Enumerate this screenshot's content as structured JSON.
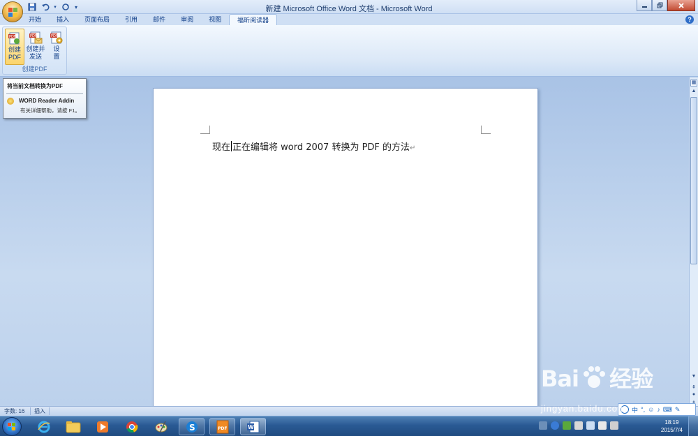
{
  "window": {
    "title": "新建 Microsoft Office Word 文档 - Microsoft Word"
  },
  "quick_access": {
    "save_icon": "save-icon",
    "undo_icon": "undo-icon",
    "redo_icon": "redo-icon"
  },
  "tabs": [
    {
      "label": "开始"
    },
    {
      "label": "插入"
    },
    {
      "label": "页面布局"
    },
    {
      "label": "引用"
    },
    {
      "label": "邮件"
    },
    {
      "label": "审阅"
    },
    {
      "label": "视图"
    },
    {
      "label": "福昕阅读器"
    }
  ],
  "active_tab": "福昕阅读器",
  "ribbon": {
    "group_label": "创建PDF",
    "buttons": [
      {
        "line1": "创建",
        "line2": "PDF"
      },
      {
        "line1": "创建并",
        "line2": "发送"
      },
      {
        "line1": "设",
        "line2": "置"
      }
    ]
  },
  "tooltip": {
    "title": "将当前文档转换为PDF",
    "addin_name": "WORD Reader Addin",
    "help_text": "有关详细帮助，请按 F1。"
  },
  "document": {
    "text_before_caret": "现在",
    "text_after_caret": "正在编辑将 word 2007 转换为 PDF 的方法",
    "paragraph_mark": "↵"
  },
  "statusbar": {
    "word_count": "字数: 16",
    "mode": "插入"
  },
  "taskbar": {
    "time": "18:19",
    "date": "2015/7/4"
  },
  "ime": {
    "mode_label": "中"
  },
  "watermark": {
    "logo_text": "Bai",
    "logo_text_end": "经验",
    "url": "jingyan.baidu.com"
  },
  "colors": {
    "ribbon_text": "#15428b",
    "accent_orange": "#f3c15a",
    "taskbar_blue": "#2a5a94"
  }
}
